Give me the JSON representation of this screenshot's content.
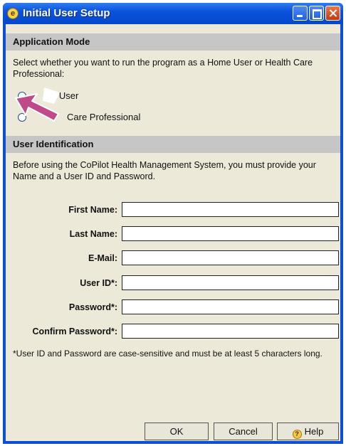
{
  "window": {
    "title": "Initial User Setup"
  },
  "app_mode": {
    "header": "Application Mode",
    "description": "Select whether you want to run the program as a Home User or Health Care Professional:",
    "options": [
      {
        "label": "Home User",
        "visible_label": "e User",
        "selected": false
      },
      {
        "label": "Health Care Professional",
        "visible_label": "Care Professional",
        "selected": false
      }
    ]
  },
  "identification": {
    "header": "User Identification",
    "description": "Before using the CoPilot Health Management System, you must provide your Name and a User ID and Password.",
    "fields": [
      {
        "label": "First Name:",
        "value": ""
      },
      {
        "label": "Last Name:",
        "value": ""
      },
      {
        "label": "E-Mail:",
        "value": ""
      },
      {
        "label": "User ID*:",
        "value": ""
      },
      {
        "label": "Password*:",
        "value": ""
      },
      {
        "label": "Confirm Password*:",
        "value": ""
      }
    ],
    "note": "*User ID and Password are case-sensitive and must be at least 5 characters long."
  },
  "buttons": {
    "ok": "OK",
    "cancel": "Cancel",
    "help": "Help"
  },
  "colors": {
    "titlebar": "#0a52de",
    "section_header": "#c6c6c6",
    "client": "#ece9d8",
    "pointer": "#c0498a"
  }
}
